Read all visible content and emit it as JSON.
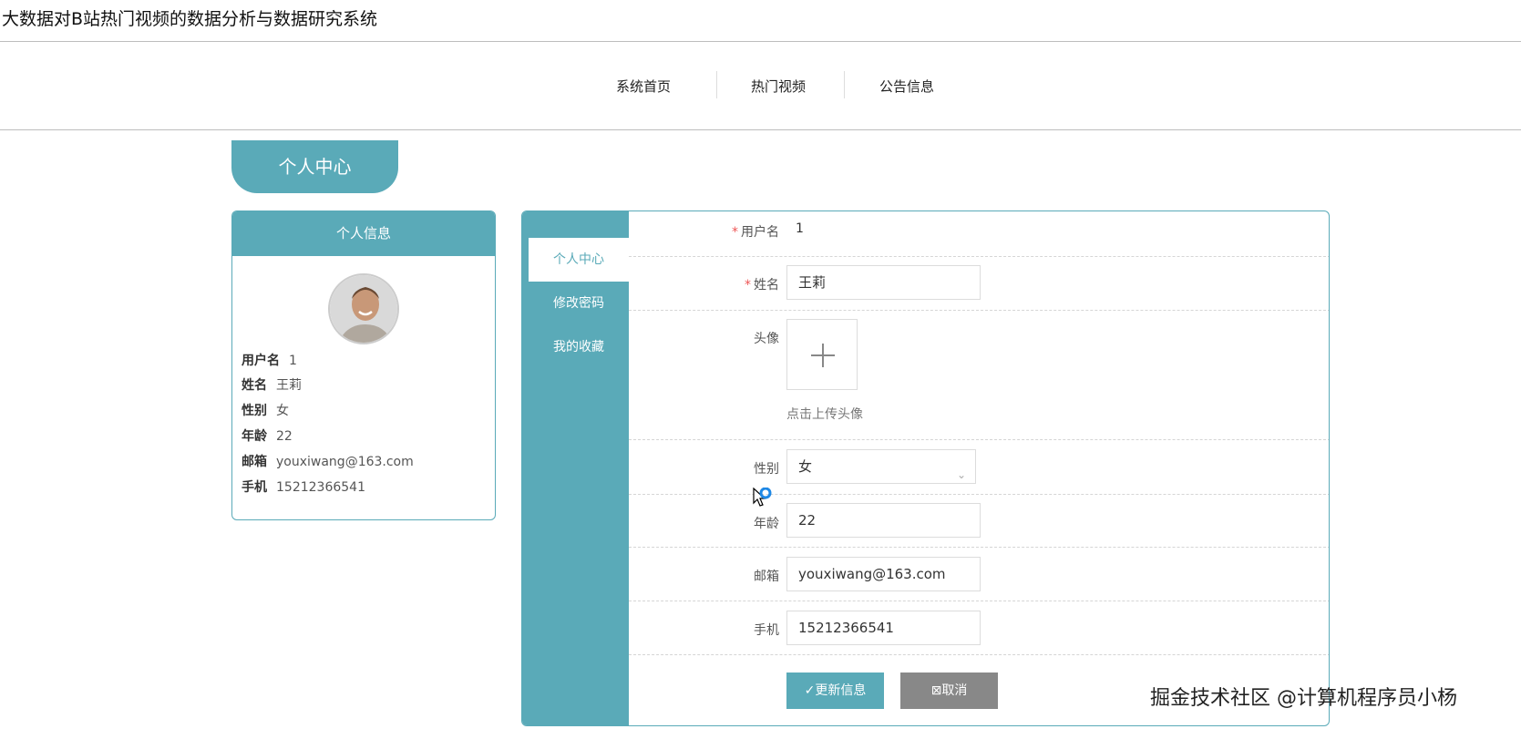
{
  "app": {
    "title": "大数据对B站热门视频的数据分析与数据研究系统"
  },
  "nav": {
    "items": [
      {
        "label": "系统首页"
      },
      {
        "label": "热门视频"
      },
      {
        "label": "公告信息"
      }
    ]
  },
  "section": {
    "title": "个人中心"
  },
  "info_card": {
    "header": "个人信息",
    "fields": [
      {
        "label": "用户名",
        "value": "1"
      },
      {
        "label": "姓名",
        "value": "王莉"
      },
      {
        "label": "性别",
        "value": "女"
      },
      {
        "label": "年龄",
        "value": "22"
      },
      {
        "label": "邮箱",
        "value": "youxiwang@163.com"
      },
      {
        "label": "手机",
        "value": "15212366541"
      }
    ]
  },
  "sidebar": {
    "items": [
      {
        "label": "个人中心",
        "active": true
      },
      {
        "label": "修改密码"
      },
      {
        "label": "我的收藏"
      }
    ]
  },
  "form": {
    "username": {
      "label": "用户名",
      "value": "1",
      "required": true
    },
    "name": {
      "label": "姓名",
      "value": "王莉",
      "required": true
    },
    "avatar": {
      "label": "头像",
      "hint": "点击上传头像"
    },
    "gender": {
      "label": "性别",
      "value": "女"
    },
    "age": {
      "label": "年龄",
      "value": "22"
    },
    "email": {
      "label": "邮箱",
      "value": "youxiwang@163.com"
    },
    "phone": {
      "label": "手机",
      "value": "15212366541"
    },
    "update_label": "更新信息",
    "cancel_label": "取消"
  },
  "watermark": {
    "text": "掘金技术社区 @计算机程序员小杨"
  },
  "colors": {
    "accent": "#5aaab8",
    "cancel": "#888888"
  }
}
